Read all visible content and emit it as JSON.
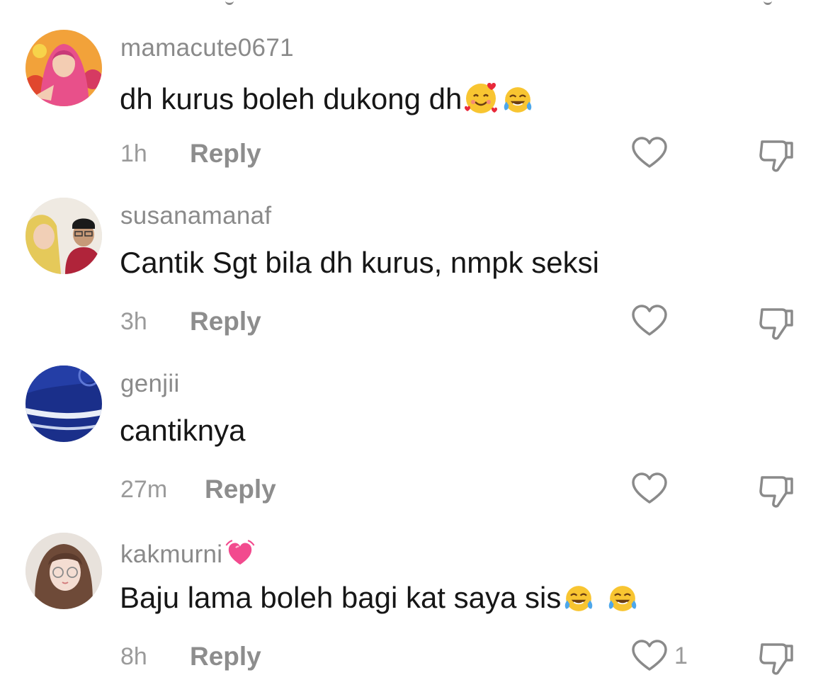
{
  "comments": [
    {
      "username": "mamacute0671",
      "text": "dh kurus boleh dukong dh",
      "emojis": [
        "smiling-face-with-hearts-emoji",
        "tears-of-joy-emoji"
      ],
      "time": "1h",
      "reply_label": "Reply",
      "like_count": "",
      "avatar": "woman-pink-hijab-flowers"
    },
    {
      "username": "susanamanaf",
      "text": "Cantik Sgt bila dh kurus, nmpk seksi",
      "emojis": [],
      "time": "3h",
      "reply_label": "Reply",
      "like_count": "",
      "avatar": "couple-photo"
    },
    {
      "username": "genjii",
      "text": "cantiknya",
      "emojis": [],
      "time": "27m",
      "reply_label": "Reply",
      "like_count": "",
      "avatar": "blue-fabric"
    },
    {
      "username": "kakmurni",
      "username_emoji": "growing-heart-emoji",
      "text": "Baju lama boleh bagi kat saya sis",
      "emojis": [
        "tears-of-joy-emoji",
        "tears-of-joy-emoji"
      ],
      "time": "8h",
      "reply_label": "Reply",
      "like_count": "1",
      "avatar": "anime-girl-glasses"
    }
  ],
  "colors": {
    "username": "#8a8a8a",
    "comment_text": "#161616",
    "meta": "#9a9a9a",
    "icon_stroke": "#8a8a8a"
  }
}
